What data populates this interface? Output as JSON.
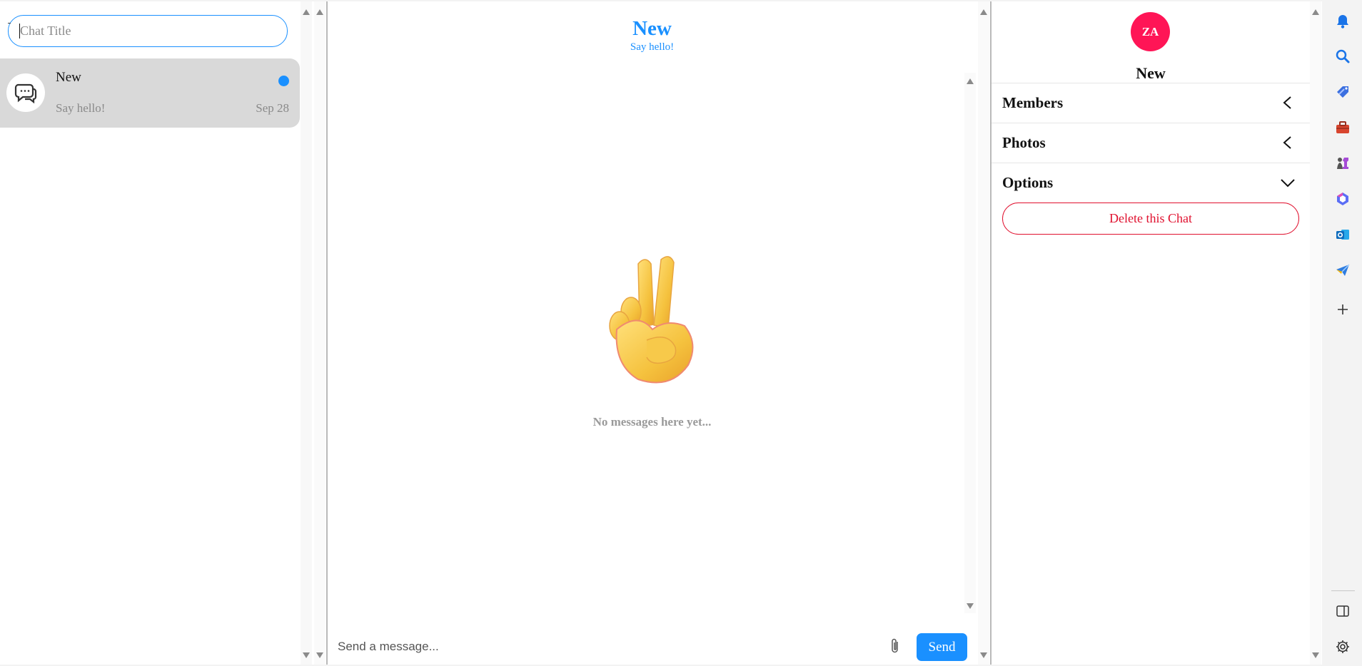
{
  "left": {
    "title_placeholder": "Chat Title",
    "chats": [
      {
        "name": "New",
        "preview": "Say hello!",
        "date": "Sep 28",
        "unread": true
      }
    ]
  },
  "conversation": {
    "title": "New",
    "subtitle": "Say hello!",
    "empty_emoji": "victory-hand",
    "empty_text": "No messages here yet...",
    "message_placeholder": "Send a message...",
    "send_label": "Send"
  },
  "details": {
    "avatar_initials": "ZA",
    "avatar_color": "#ff1556",
    "name": "New",
    "sections": [
      {
        "label": "Members",
        "state": "collapsed"
      },
      {
        "label": "Photos",
        "state": "collapsed"
      },
      {
        "label": "Options",
        "state": "expanded"
      }
    ],
    "delete_label": "Delete this Chat"
  },
  "sidebar": {
    "icons": [
      "bell-icon",
      "search-icon",
      "tag-icon",
      "toolbox-icon",
      "chess-icon",
      "copilot-icon",
      "outlook-icon",
      "send-icon",
      "plus-icon",
      "sidebar-panel-icon",
      "settings-icon"
    ]
  },
  "colors": {
    "accent": "#1a90ff",
    "danger": "#e0102e",
    "selected_row": "#d9d9d9"
  }
}
